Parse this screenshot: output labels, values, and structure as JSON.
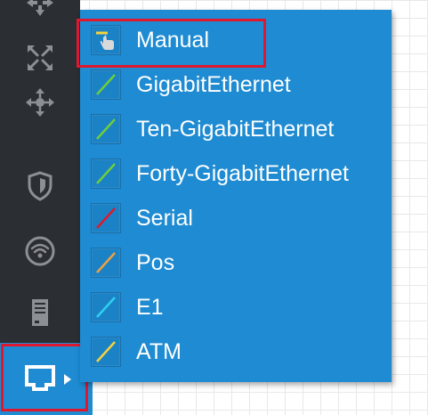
{
  "rail": {
    "icons": [
      {
        "name": "router-icon"
      },
      {
        "name": "switch-icon"
      },
      {
        "name": "hub-icon"
      },
      {
        "name": "security-icon"
      },
      {
        "name": "wireless-icon"
      },
      {
        "name": "server-icon"
      },
      {
        "name": "connections-icon"
      }
    ],
    "active": "connections-icon",
    "active_color": "#1e8bd2",
    "background": "#2b2e33"
  },
  "menu": {
    "background": "#1e8bd2",
    "items": [
      {
        "label": "Manual",
        "icon": "manual-icon",
        "color": "#f5d23c",
        "selected": true
      },
      {
        "label": "GigabitEthernet",
        "icon": "gigabitethernet-cable-icon",
        "color": "#6fce3a"
      },
      {
        "label": "Ten-GigabitEthernet",
        "icon": "ten-gigabitethernet-cable-icon",
        "color": "#6fce3a"
      },
      {
        "label": "Forty-GigabitEthernet",
        "icon": "forty-gigabitethernet-cable-icon",
        "color": "#6fce3a"
      },
      {
        "label": "Serial",
        "icon": "serial-cable-icon",
        "color": "#e0182d"
      },
      {
        "label": "Pos",
        "icon": "pos-cable-icon",
        "color": "#f0a040"
      },
      {
        "label": "E1",
        "icon": "e1-cable-icon",
        "color": "#2fd0f0"
      },
      {
        "label": "ATM",
        "icon": "atm-cable-icon",
        "color": "#f5d23c"
      }
    ]
  },
  "highlight_color": "#e0182d"
}
